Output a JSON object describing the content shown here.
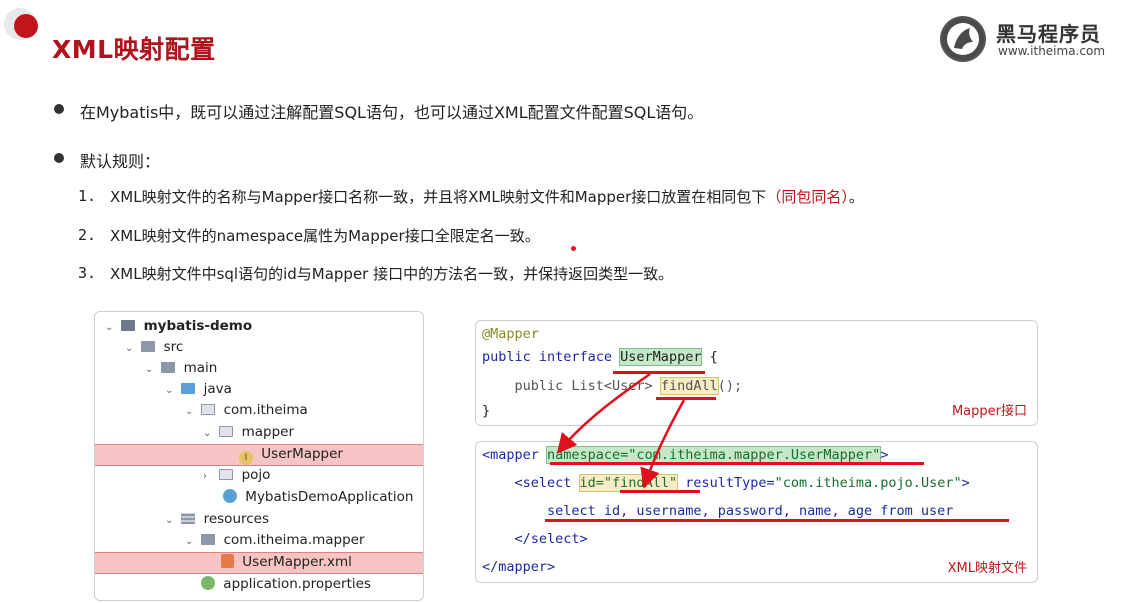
{
  "slide": {
    "title": "XML映射配置",
    "logo": {
      "name": "黑马程序员",
      "url": "www.itheima.com"
    },
    "bullets": [
      "在Mybatis中，既可以通过注解配置SQL语句，也可以通过XML配置文件配置SQL语句。",
      "默认规则："
    ],
    "rules": [
      {
        "num": "1.",
        "text": "XML映射文件的名称与Mapper接口名称一致，并且将XML映射文件和Mapper接口放置在相同包下",
        "emph": "（同包同名）",
        "tail": "。"
      },
      {
        "num": "2.",
        "text": "XML映射文件的namespace属性为Mapper接口全限定名一致。"
      },
      {
        "num": "3.",
        "text": "XML映射文件中sql语句的id与Mapper 接口中的方法名一致，并保持返回类型一致。"
      }
    ]
  },
  "tree": {
    "items": [
      {
        "label": "mybatis-demo",
        "chev": "⌄"
      },
      {
        "label": "src",
        "chev": "⌄"
      },
      {
        "label": "main",
        "chev": "⌄"
      },
      {
        "label": "java",
        "chev": "⌄"
      },
      {
        "label": "com.itheima",
        "chev": "⌄"
      },
      {
        "label": "mapper",
        "chev": "⌄"
      },
      {
        "label": "UserMapper",
        "chev": ""
      },
      {
        "label": "pojo",
        "chev": "›"
      },
      {
        "label": "MybatisDemoApplication",
        "chev": ""
      },
      {
        "label": "resources",
        "chev": "⌄"
      },
      {
        "label": "com.itheima.mapper",
        "chev": "⌄"
      },
      {
        "label": "UserMapper.xml",
        "chev": ""
      },
      {
        "label": "application.properties",
        "chev": ""
      }
    ]
  },
  "java_code": {
    "l1": "@Mapper",
    "l2_kw": "public interface ",
    "l2_name": "UserMapper",
    "l2_tail": " {",
    "l3_pre": "    public List<User> ",
    "l3_method": "findAll",
    "l3_tail": "();",
    "l4": "}",
    "caption": "Mapper接口"
  },
  "xml_code": {
    "l1_open": "<mapper ",
    "l1_attr": "namespace=\"com.itheima.mapper.UserMapper\"",
    "l1_close": ">",
    "l2_open": "    <select ",
    "l2_id": "id=\"findAll\"",
    "l2_rest_attr": " resultType=",
    "l2_rest_val": "\"com.itheima.pojo.User\"",
    "l2_close": ">",
    "l3": "        select id, username, password, name, age from user",
    "l4": "    </select>",
    "l5": "</mapper>",
    "caption": "XML映射文件"
  },
  "colors": {
    "accent": "#b1121b",
    "highlight_row": "#f6c4c4",
    "underline": "#e0101c"
  }
}
